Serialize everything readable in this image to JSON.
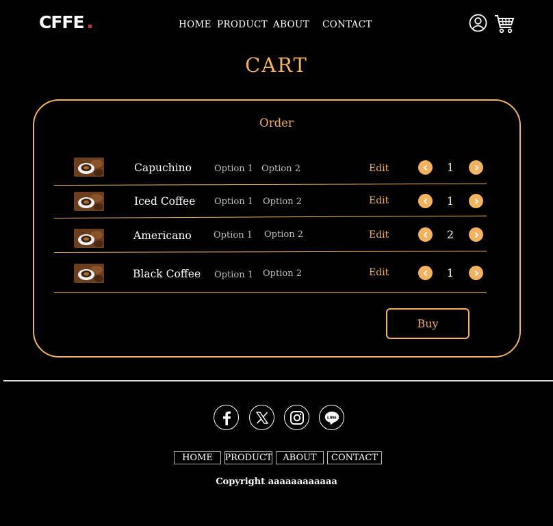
{
  "brand": {
    "logo": "CFFE",
    "dot_color": "#e0282e"
  },
  "nav": {
    "home": "HOME",
    "product": "PRODUCT",
    "about": "ABOUT",
    "contact": "CONTACT"
  },
  "header_icons": [
    "user-icon",
    "cart-icon"
  ],
  "page": {
    "title": "CART"
  },
  "order": {
    "title": "Order",
    "items": [
      {
        "name": "Capuchino",
        "option1": "Option 1",
        "option2": "Option 2",
        "edit": "Edit",
        "qty": "1"
      },
      {
        "name": "Iced Coffee",
        "option1": "Option 1",
        "option2": "Option 2",
        "edit": "Edit",
        "qty": "1"
      },
      {
        "name": "Americano",
        "option1": "Option 1",
        "option2": "Option 2",
        "edit": "Edit",
        "qty": "2"
      },
      {
        "name": "Black Coffee",
        "option1": "Option 1",
        "option2": "Option 2",
        "edit": "Edit",
        "qty": "1"
      }
    ],
    "buy_label": "Buy"
  },
  "footer": {
    "social": [
      "facebook-icon",
      "x-icon",
      "instagram-icon",
      "line-icon"
    ],
    "links": {
      "home": "HOME",
      "product": "PRODUCT",
      "about": "ABOUT",
      "contact": "CONTACT"
    },
    "copyright": "Copyright aaaaaaaaaaaa"
  },
  "colors": {
    "accent": "#f2b25e",
    "background": "#000000",
    "text": "#ffffff"
  }
}
